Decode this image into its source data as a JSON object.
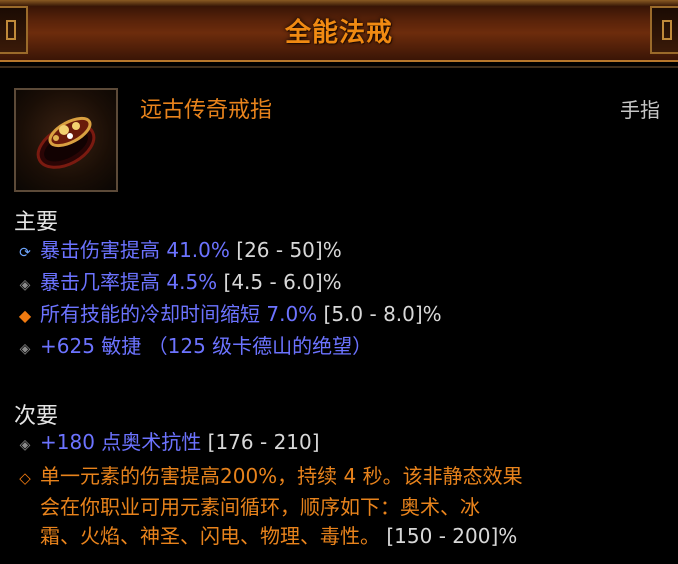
{
  "header": {
    "title": "全能法戒"
  },
  "item": {
    "name": "远古传奇戒指",
    "slot": "手指",
    "icon": "legendary-ring-icon"
  },
  "primary": {
    "heading": "主要",
    "stats": [
      {
        "bullet": "reroll-icon",
        "text": "暴击伤害提高 41.0%",
        "range": "[26 - 50]%"
      },
      {
        "bullet": "diamond-icon",
        "text": "暴击几率提高 4.5%",
        "range": "[4.5 - 6.0]%"
      },
      {
        "bullet": "diamond-orange-icon",
        "text": "所有技能的冷却时间缩短 7.0%",
        "range": "[5.0 - 8.0]%"
      },
      {
        "bullet": "diamond-icon",
        "text": "+625 敏捷 （125 级卡德山的绝望）",
        "range": ""
      }
    ]
  },
  "secondary": {
    "heading": "次要",
    "stats": [
      {
        "bullet": "diamond-icon",
        "text": "+180 点奥术抗性",
        "range": "[176 - 210]"
      }
    ],
    "legendary": {
      "bullet": "diamond-outline-orange-icon",
      "line1": "单一元素的伤害提高200%，持续 4 秒。该非静态效果",
      "line2": "会在你职业可用元素间循环，顺序如下：奥术、冰",
      "line3": "霜、火焰、神圣、闪电、物理、毒性。",
      "range": "[150 - 200]%"
    }
  },
  "colors": {
    "title": "#f08a12",
    "legendary": "#e8831c",
    "magic": "#6c73ff",
    "range": "#d8d8d8"
  }
}
